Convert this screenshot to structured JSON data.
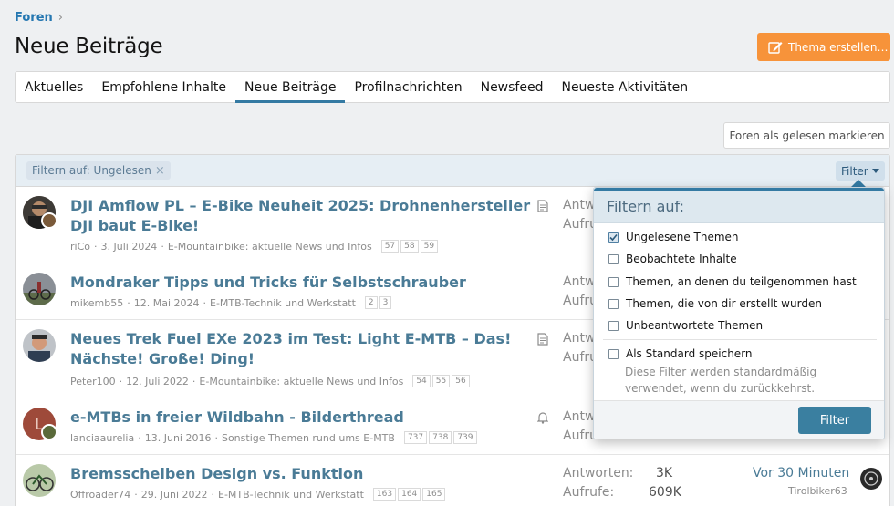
{
  "breadcrumb": {
    "label": "Foren",
    "chevron": "›"
  },
  "page": {
    "title": "Neue Beiträge"
  },
  "actions": {
    "new_thread": "Thema erstellen…",
    "mark_read": "Foren als gelesen markieren"
  },
  "tabs": [
    {
      "label": "Aktuelles"
    },
    {
      "label": "Empfohlene Inhalte"
    },
    {
      "label": "Neue Beiträge",
      "active": true
    },
    {
      "label": "Profilnachrichten"
    },
    {
      "label": "Newsfeed"
    },
    {
      "label": "Neueste Aktivitäten"
    }
  ],
  "list_header": {
    "filter_chip": "Filtern auf: Ungelesen",
    "filter_chip_close": "×",
    "filter_button": "Filter"
  },
  "threads": [
    {
      "title": "DJI Amflow PL – E-Bike Neuheit 2025: Drohnenhersteller DJI baut E-Bike!",
      "author": "riCo",
      "date": "3. Juli 2024",
      "forum": "E-Mountainbike: aktuelle News und Infos",
      "pages": [
        "57",
        "58",
        "59"
      ],
      "stat_label": "Antw",
      "stat_sub": "Aufruf"
    },
    {
      "title": "Mondraker Tipps und Tricks für Selbstschrauber",
      "author": "mikemb55",
      "date": "12. Mai 2024",
      "forum": "E-MTB-Technik und Werkstatt",
      "pages": [
        "2",
        "3"
      ],
      "stat_label": "Antw",
      "stat_sub": "Aufruf"
    },
    {
      "title": "Neues Trek Fuel EXe 2023 im Test: Light E-MTB – Das! Nächste! Große! Ding!",
      "author": "Peter100",
      "date": "12. Juli 2022",
      "forum": "E-Mountainbike: aktuelle News und Infos",
      "pages": [
        "54",
        "55",
        "56"
      ],
      "stat_label": "Antw",
      "stat_sub": "Aufruf"
    },
    {
      "title": "e-MTBs in freier Wildbahn - Bilderthread",
      "author": "lanciaaurelia",
      "date": "13. Juni 2016",
      "forum": "Sonstige Themen rund ums E-MTB",
      "pages": [
        "737",
        "738",
        "739"
      ],
      "stat_label": "Antw",
      "stat_sub": "Aufruf"
    },
    {
      "title": "Bremsscheiben Design vs. Funktion",
      "author": "Offroader74",
      "date": "29. Juni 2022",
      "forum": "E-MTB-Technik und Werkstatt",
      "pages": [
        "163",
        "164",
        "165"
      ],
      "stat_label": "Antworten:",
      "stat_value": "3K",
      "stat_sub": "Aufrufe:",
      "stat_sub_value": "609K",
      "last_time": "Vor 30 Minuten",
      "last_user": "Tirolbiker63"
    }
  ],
  "filter_menu": {
    "title": "Filtern auf:",
    "options": [
      {
        "label": "Ungelesene Themen",
        "checked": true
      },
      {
        "label": "Beobachtete Inhalte",
        "checked": false
      },
      {
        "label": "Themen, an denen du teilgenommen hast",
        "checked": false
      },
      {
        "label": "Themen, die von dir erstellt wurden",
        "checked": false
      },
      {
        "label": "Unbeantwortete Themen",
        "checked": false
      }
    ],
    "save_default": {
      "label": "Als Standard speichern",
      "checked": false,
      "description": "Diese Filter werden standardmäßig verwendet, wenn du zurückkehrst."
    },
    "apply": "Filter"
  },
  "colors": {
    "accent": "#347aa3",
    "title_link": "#4a7b96",
    "new_button": "#f7933a",
    "header_bg": "#e6eef4"
  }
}
